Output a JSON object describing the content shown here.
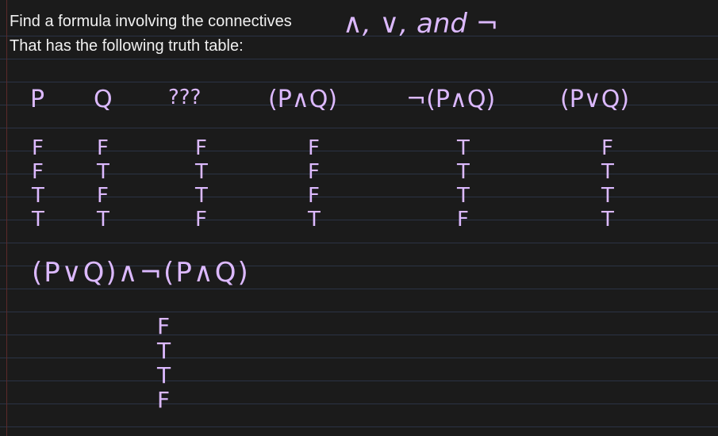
{
  "header": {
    "line1": "Find a formula involving the connectives",
    "line2": "That has the following truth table:",
    "connectives_handwritten": "∧, ∨, and ¬"
  },
  "table": {
    "headers": [
      "P",
      "Q",
      "???",
      "(P∧Q)",
      "¬(P∧Q)",
      "(P∨Q)"
    ],
    "columns": [
      [
        "F",
        "F",
        "T",
        "T"
      ],
      [
        "F",
        "T",
        "F",
        "T"
      ],
      [
        "F",
        "T",
        "T",
        "F"
      ],
      [
        "F",
        "F",
        "F",
        "T"
      ],
      [
        "T",
        "T",
        "T",
        "F"
      ],
      [
        "F",
        "T",
        "T",
        "T"
      ]
    ]
  },
  "answer": {
    "formula": "(P∨Q)∧¬(P∧Q)",
    "values": [
      "F",
      "T",
      "T",
      "F"
    ]
  },
  "colors": {
    "background": "#1b1b1b",
    "rule_line": "#2b3345",
    "typed_text": "#f0f0f0",
    "ink": "#dcb9ff"
  }
}
